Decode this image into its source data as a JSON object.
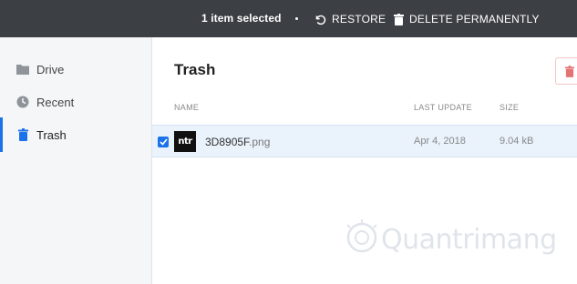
{
  "toolbar": {
    "selection_text": "1 item selected",
    "restore_label": "RESTORE",
    "delete_label": "DELETE PERMANENTLY"
  },
  "sidebar": {
    "items": [
      {
        "label": "Drive",
        "icon": "folder-icon",
        "active": false
      },
      {
        "label": "Recent",
        "icon": "clock-icon",
        "active": false
      },
      {
        "label": "Trash",
        "icon": "trash-icon",
        "active": true
      }
    ]
  },
  "main": {
    "title": "Trash",
    "columns": [
      "NAME",
      "LAST UPDATE",
      "SIZE"
    ],
    "rows": [
      {
        "thumb_text": "ntr",
        "name": "3D8905F",
        "ext": ".png",
        "last_update": "Apr 4, 2018",
        "size": "9.04 kB",
        "selected": true
      }
    ]
  },
  "watermark": {
    "text": "Quantrimang"
  },
  "colors": {
    "topbar": "#3c3f44",
    "accent": "#1a73e8",
    "selected_row": "#eaf2fc",
    "sidebar": "#f5f6f7"
  }
}
